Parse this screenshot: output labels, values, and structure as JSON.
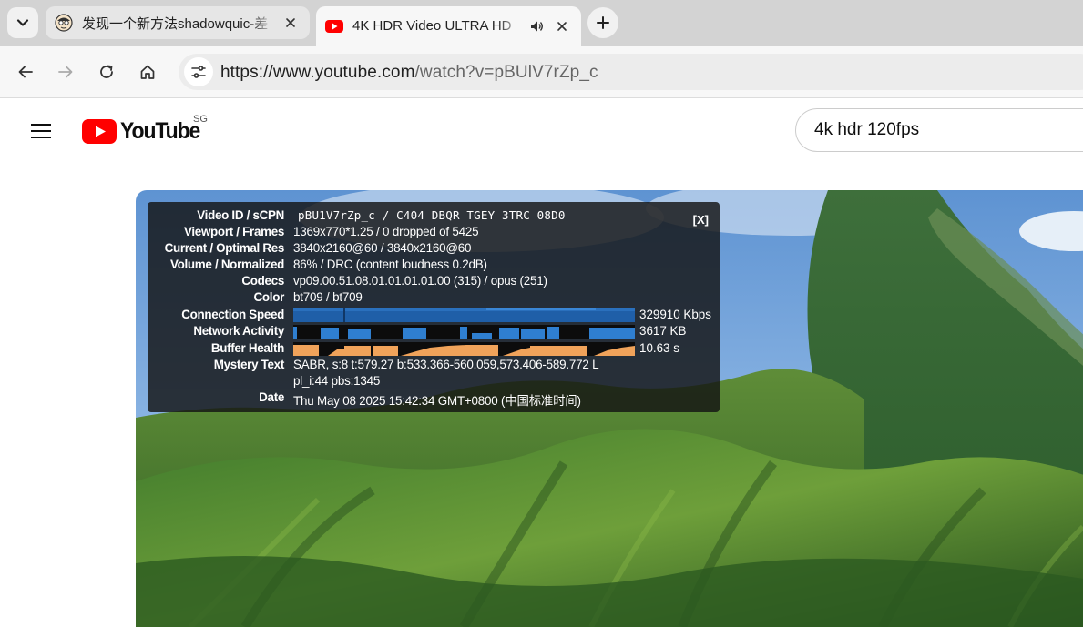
{
  "tabs": [
    {
      "title": "发现一个新方法shadowquic-差",
      "active": false,
      "favicon": "cartoon-face-icon"
    },
    {
      "title": "4K HDR Video ULTRA HD",
      "active": true,
      "favicon": "youtube-icon",
      "audio": true
    }
  ],
  "address_bar": {
    "url_host": "https://www.youtube.com",
    "url_path": "/watch?v=pBUlV7rZp_c"
  },
  "youtube": {
    "logo_text": "YouTube",
    "country": "SG",
    "search_value": "4k hdr 120fps"
  },
  "stats_for_nerds": {
    "close_label": "[X]",
    "rows": [
      {
        "label": "Video ID / sCPN",
        "value": "pBU1V7rZp_c / C404 DBQR TGEY 3TRC 08D0"
      },
      {
        "label": "Viewport / Frames",
        "value": "1369x770*1.25 / 0 dropped of 5425"
      },
      {
        "label": "Current / Optimal Res",
        "value": "3840x2160@60 / 3840x2160@60"
      },
      {
        "label": "Volume / Normalized",
        "value": "86% / DRC (content loudness 0.2dB)"
      },
      {
        "label": "Codecs",
        "value": "vp09.00.51.08.01.01.01.01.00 (315) / opus (251)"
      },
      {
        "label": "Color",
        "value": "bt709 / bt709"
      },
      {
        "label": "Connection Speed",
        "value": "329910 Kbps"
      },
      {
        "label": "Network Activity",
        "value": "3617 KB"
      },
      {
        "label": "Buffer Health",
        "value": "10.63 s"
      },
      {
        "label": "Mystery Text",
        "value": "SABR, s:8 t:579.27 b:533.366-560.059,573.406-589.772 L",
        "value2": "pl_i:44 pbs:1345"
      },
      {
        "label": "Date",
        "value": "Thu May 08 2025 15:42:34 GMT+0800 (中国标准时间)"
      }
    ]
  },
  "colors": {
    "youtube_red": "#ff0000",
    "connection_graph": "#1f5fa8",
    "network_graph": "#2f7fd0",
    "buffer_graph": "#f0a35a"
  }
}
